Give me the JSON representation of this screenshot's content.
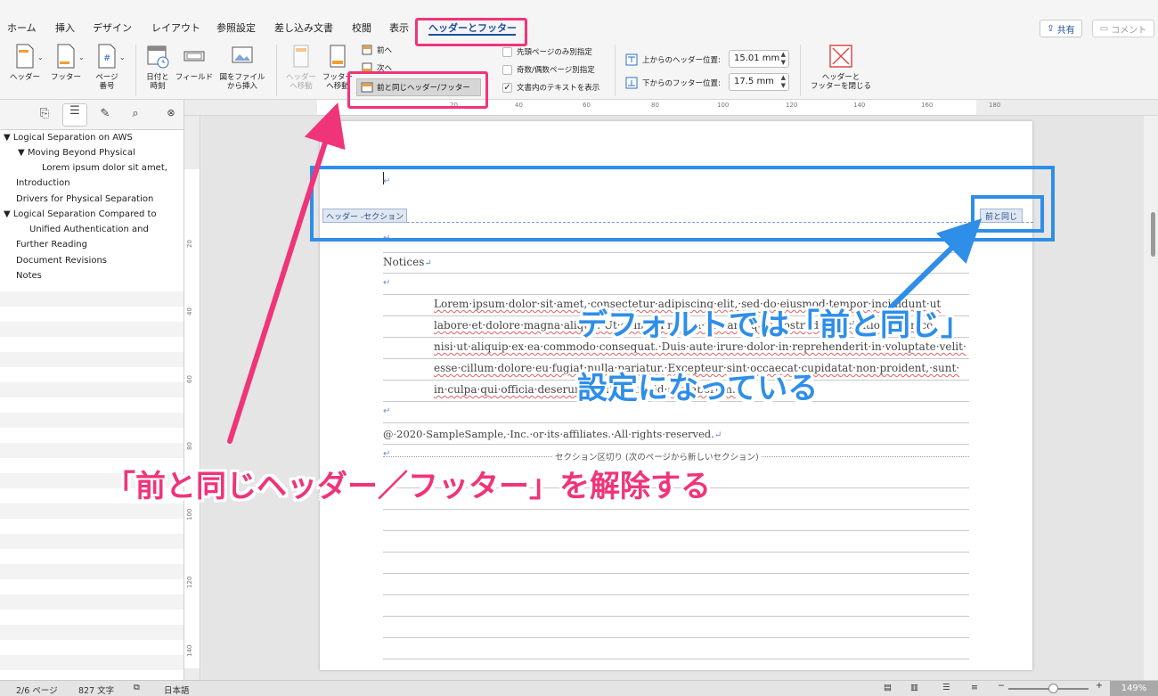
{
  "tabs": [
    {
      "label": "ホーム"
    },
    {
      "label": "挿入"
    },
    {
      "label": "デザイン"
    },
    {
      "label": "レイアウト"
    },
    {
      "label": "参照設定"
    },
    {
      "label": "差し込み文書"
    },
    {
      "label": "校閲"
    },
    {
      "label": "表示"
    },
    {
      "label": "ヘッダーとフッター"
    }
  ],
  "share_label": "共有",
  "comment_label": "コメント",
  "ribbon": {
    "header_btn": "ヘッダー",
    "footer_btn": "フッター",
    "page_number_btn_1": "ページ",
    "page_number_btn_2": "番号",
    "datetime_btn_1": "日付と",
    "datetime_btn_2": "時刻",
    "field_btn": "フィールド",
    "picture_btn_1": "図をファイル",
    "picture_btn_2": "から挿入",
    "goto_header_1": "ヘッダー",
    "goto_header_2": "へ移動",
    "goto_footer_1": "フッター",
    "goto_footer_2": "へ移動",
    "prev_btn": "前へ",
    "next_btn": "次へ",
    "link_previous_btn": "前と同じヘッダー/フッター",
    "first_page_diff": "先頭ページのみ別指定",
    "odd_even_diff": "奇数/偶数ページ別指定",
    "show_doc_text": "文書内のテキストを表示",
    "header_pos_label": "上からのヘッダー位置:",
    "header_pos_value": "15.01 mm",
    "footer_pos_label": "下からのフッター位置:",
    "footer_pos_value": "17.5 mm",
    "close_btn_1": "ヘッダーと",
    "close_btn_2": "フッターを閉じる"
  },
  "ruler_ticks": [
    "20",
    "40",
    "60",
    "80",
    "100",
    "120",
    "140",
    "160",
    "180"
  ],
  "vruler_ticks": [
    "20",
    "40",
    "60",
    "80",
    "100",
    "120",
    "140"
  ],
  "sidebar": {
    "items": [
      {
        "label": "Logical Separation on AWS"
      },
      {
        "label": "Moving Beyond Physical"
      },
      {
        "label": "Lorem ipsum dolor sit amet,"
      },
      {
        "label": "Introduction"
      },
      {
        "label": "Drivers for Physical Separation"
      },
      {
        "label": "Logical Separation Compared to"
      },
      {
        "label": "Unified Authentication and"
      },
      {
        "label": "Further Reading"
      },
      {
        "label": "Document Revisions"
      },
      {
        "label": "Notes"
      }
    ]
  },
  "document": {
    "header_section_label": "ヘッダー -セクション",
    "same_as_previous_label": "前と同じ",
    "notices": "Notices",
    "para_lines": [
      "Lorem·ipsum·dolor·sit·amet,·consectetur·adipiscing·elit,·sed·do·eiusmod·tempor·incididunt·ut",
      "labore·et·dolore·magna·aliqua.·Ut·enim·ad·minim·veniam,·quis·nostrud·exercitation·ullamco",
      "nisi·ut·aliquip·ex·ea·commodo·consequat.·Duis·aute·irure·dolor·in·reprehenderit·in·voluptate·velit·",
      "esse·cillum·dolore·eu·fugiat·nulla·pariatur.·Excepteur·sint·occaecat·cupidatat·non·proident,·sunt·",
      "in·culpa·qui·officia·deserunt·mollit·anim·id·est·laborum."
    ],
    "copyright": "@·2020·SampleSample,·Inc.·or·its·affiliates.·All·rights·reserved.",
    "section_break": "セクション区切り (次のページから新しいセクション)",
    "para_mark": "↵"
  },
  "status": {
    "page": "2/6 ページ",
    "words": "827 文字",
    "language": "日本語",
    "zoom": "149%"
  },
  "annotations": {
    "blue_line1": "デフォルトでは「前と同じ」",
    "blue_line2": "設定になっている",
    "pink_text": "「前と同じヘッダー／フッター」を解除する",
    "blue_color": "#2e8ee8",
    "pink_color": "#f0347a"
  }
}
